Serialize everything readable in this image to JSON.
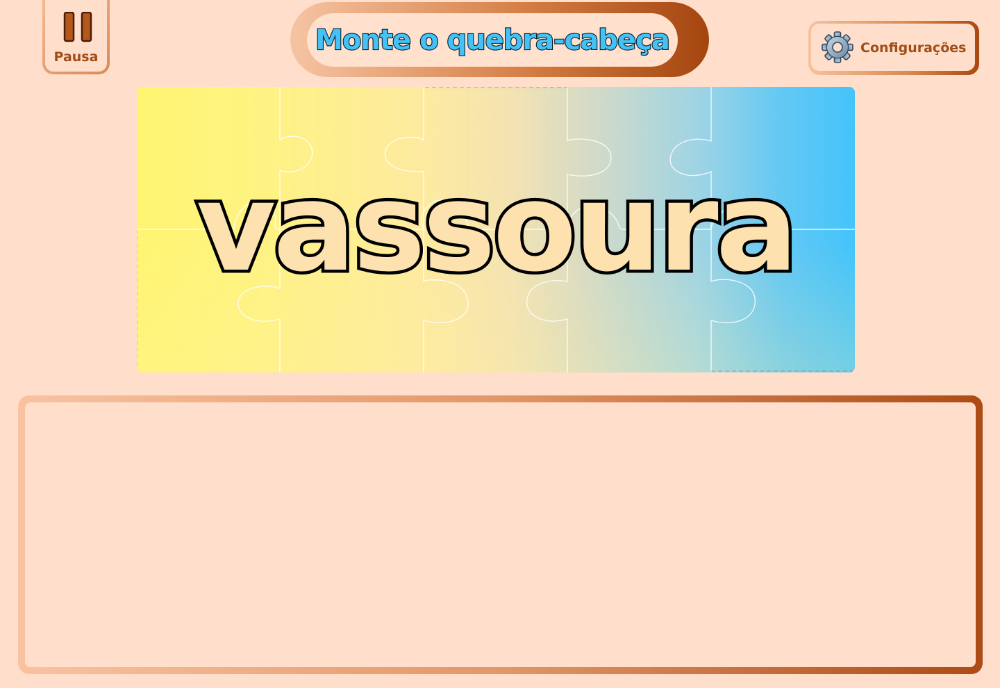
{
  "pause": {
    "label": "Pausa",
    "icon": "pause-icon"
  },
  "header": {
    "title": "Monte o quebra-cabeça"
  },
  "settings": {
    "label": "Configurações",
    "icon": "gear-icon"
  },
  "puzzle": {
    "word": "vassoura",
    "columns": 5,
    "rows": 2,
    "gradient_start": "#fff572",
    "gradient_end": "#44c4fb"
  },
  "colors": {
    "background": "#ffdfcb",
    "accent": "#a24c16",
    "title_fill": "#44c2f5"
  }
}
